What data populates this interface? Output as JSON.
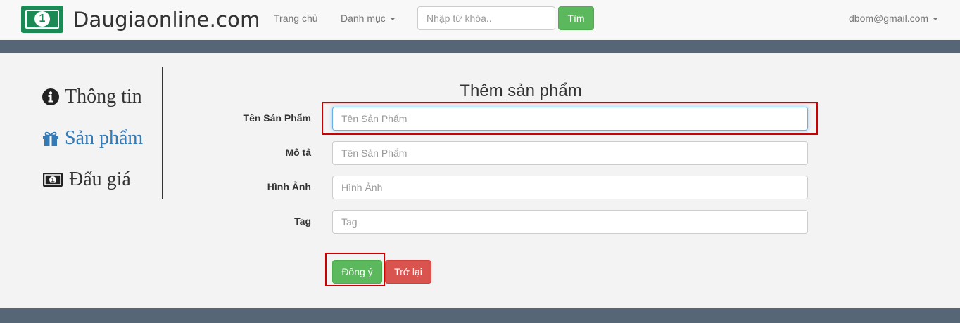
{
  "navbar": {
    "brand_name": "Daugiaonline.com",
    "logo_glyph": "1",
    "links": {
      "home": "Trang chủ",
      "categories": "Danh mục"
    },
    "search": {
      "placeholder": "Nhập từ khóa..",
      "value": "",
      "button_label": "Tìm"
    },
    "user_email": "dbom@gmail.com"
  },
  "sidebar": {
    "items": [
      {
        "label": "Thông tin",
        "icon": "info-circle-icon",
        "active": false
      },
      {
        "label": "Sản phẩm",
        "icon": "gift-icon",
        "active": true
      },
      {
        "label": "Đấu giá",
        "icon": "money-bill-icon",
        "active": false
      }
    ]
  },
  "form": {
    "title": "Thêm sản phẩm",
    "fields": [
      {
        "label": "Tên Sản Phẩm",
        "placeholder": "Tên Sản Phẩm",
        "value": ""
      },
      {
        "label": "Mô tả",
        "placeholder": "Tên Sản Phẩm",
        "value": ""
      },
      {
        "label": "Hình Ảnh",
        "placeholder": "Hình Ảnh",
        "value": ""
      },
      {
        "label": "Tag",
        "placeholder": "Tag",
        "value": ""
      }
    ],
    "submit_label": "Đồng ý",
    "back_label": "Trở lại"
  },
  "colors": {
    "brand_green": "#1c8a55",
    "success": "#5cb85c",
    "danger": "#d9534f",
    "band": "#566676",
    "active_link": "#337ab7",
    "highlight": "#cc0000"
  }
}
